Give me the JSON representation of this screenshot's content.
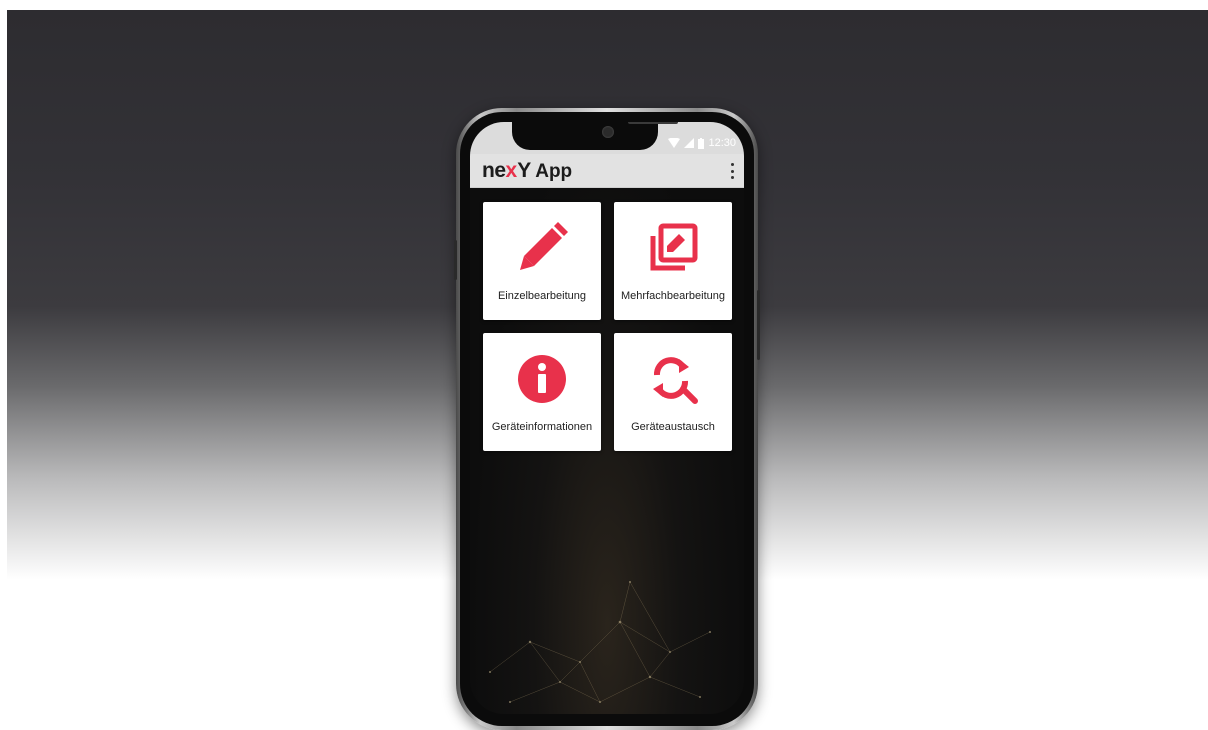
{
  "statusbar": {
    "time": "12:30"
  },
  "appbar": {
    "brand_ne": "ne",
    "brand_x": "x",
    "brand_y": "Y",
    "title": "App",
    "menu_icon": "more-vert-icon"
  },
  "tiles": [
    {
      "label": "Einzelbearbeitung",
      "icon": "pencil-icon"
    },
    {
      "label": "Mehrfachbearbeitung",
      "icon": "multi-edit-icon"
    },
    {
      "label": "Geräteinformationen",
      "icon": "info-icon"
    },
    {
      "label": "Geräteaustausch",
      "icon": "search-refresh-icon"
    }
  ],
  "colors": {
    "accent": "#e8314b",
    "appbar": "#e2e2e2",
    "tile": "#ffffff"
  }
}
